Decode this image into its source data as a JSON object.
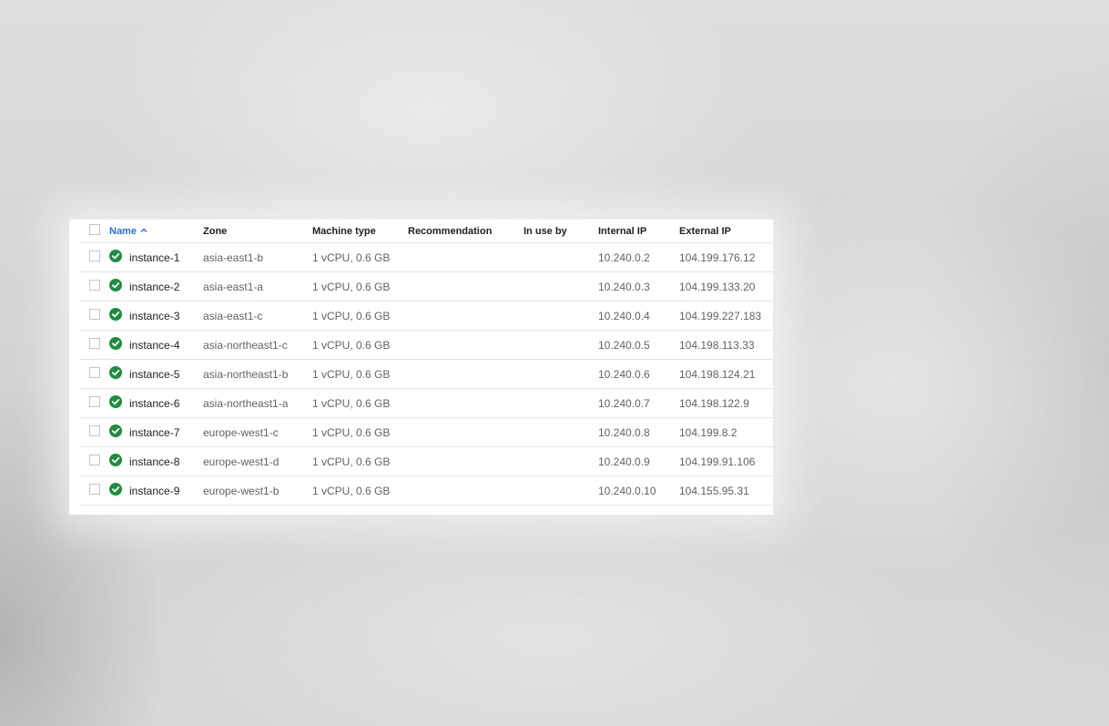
{
  "table": {
    "columns": {
      "name": "Name",
      "zone": "Zone",
      "machine_type": "Machine type",
      "recommendation": "Recommendation",
      "in_use_by": "In use by",
      "internal_ip": "Internal IP",
      "external_ip": "External IP"
    },
    "sort": {
      "column": "name",
      "direction": "ascending",
      "icon": "arrow-up-icon"
    },
    "status_icon": "check-circle-icon",
    "status_color": "#1e8e3e",
    "accent_color": "#1a73e8",
    "rows": [
      {
        "name": "instance-1",
        "zone": "asia-east1-b",
        "machine_type": "1 vCPU, 0.6 GB",
        "recommendation": "",
        "in_use_by": "",
        "internal_ip": "10.240.0.2",
        "external_ip": "104.199.176.12"
      },
      {
        "name": "instance-2",
        "zone": "asia-east1-a",
        "machine_type": "1 vCPU, 0.6 GB",
        "recommendation": "",
        "in_use_by": "",
        "internal_ip": "10.240.0.3",
        "external_ip": "104.199.133.20"
      },
      {
        "name": "instance-3",
        "zone": "asia-east1-c",
        "machine_type": "1 vCPU, 0.6 GB",
        "recommendation": "",
        "in_use_by": "",
        "internal_ip": "10.240.0.4",
        "external_ip": "104.199.227.183"
      },
      {
        "name": "instance-4",
        "zone": "asia-northeast1-c",
        "machine_type": "1 vCPU, 0.6 GB",
        "recommendation": "",
        "in_use_by": "",
        "internal_ip": "10.240.0.5",
        "external_ip": "104.198.113.33"
      },
      {
        "name": "instance-5",
        "zone": "asia-northeast1-b",
        "machine_type": "1 vCPU, 0.6 GB",
        "recommendation": "",
        "in_use_by": "",
        "internal_ip": "10.240.0.6",
        "external_ip": "104.198.124.21"
      },
      {
        "name": "instance-6",
        "zone": "asia-northeast1-a",
        "machine_type": "1 vCPU, 0.6 GB",
        "recommendation": "",
        "in_use_by": "",
        "internal_ip": "10.240.0.7",
        "external_ip": "104.198.122.9"
      },
      {
        "name": "instance-7",
        "zone": "europe-west1-c",
        "machine_type": "1 vCPU, 0.6 GB",
        "recommendation": "",
        "in_use_by": "",
        "internal_ip": "10.240.0.8",
        "external_ip": "104.199.8.2"
      },
      {
        "name": "instance-8",
        "zone": "europe-west1-d",
        "machine_type": "1 vCPU, 0.6 GB",
        "recommendation": "",
        "in_use_by": "",
        "internal_ip": "10.240.0.9",
        "external_ip": "104.199.91.106"
      },
      {
        "name": "instance-9",
        "zone": "europe-west1-b",
        "machine_type": "1 vCPU, 0.6 GB",
        "recommendation": "",
        "in_use_by": "",
        "internal_ip": "10.240.0.10",
        "external_ip": "104.155.95.31"
      }
    ]
  }
}
